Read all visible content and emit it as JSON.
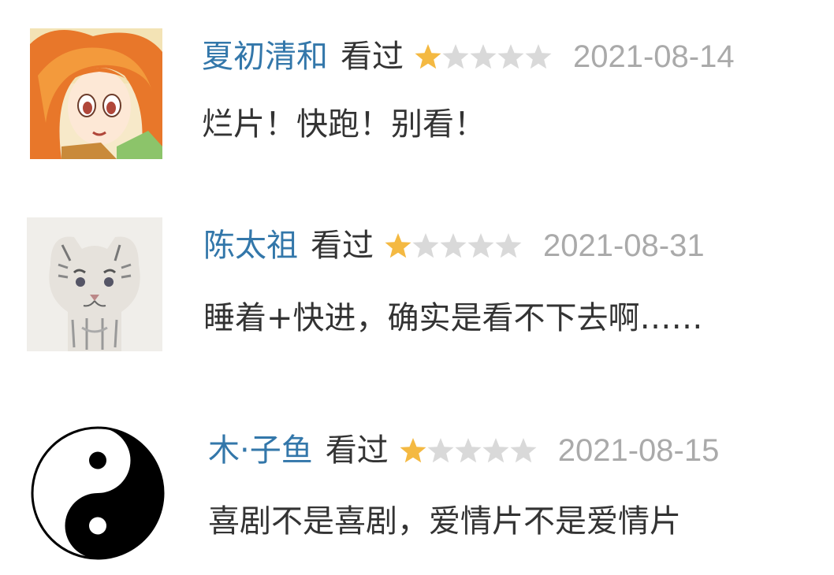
{
  "reviews": [
    {
      "username": "夏初清和",
      "status": "看过",
      "rating": 1,
      "max_rating": 5,
      "date": "2021-08-14",
      "comment": "烂片！快跑！别看！",
      "avatar_icon": "anime-girl-avatar"
    },
    {
      "username": "陈太祖",
      "status": "看过",
      "rating": 1,
      "max_rating": 5,
      "date": "2021-08-31",
      "comment": "睡着+快进，确实是看不下去啊……",
      "avatar_icon": "white-tiger-cub-avatar"
    },
    {
      "username": "木·子鱼",
      "status": "看过",
      "rating": 1,
      "max_rating": 5,
      "date": "2021-08-15",
      "comment": "喜剧不是喜剧，爱情片不是爱情片",
      "avatar_icon": "yin-yang-avatar"
    }
  ],
  "colors": {
    "username": "#3377aa",
    "star_filled": "#f4b942",
    "star_empty": "#d9d9d9",
    "date": "#aaaaaa",
    "text": "#333333"
  }
}
